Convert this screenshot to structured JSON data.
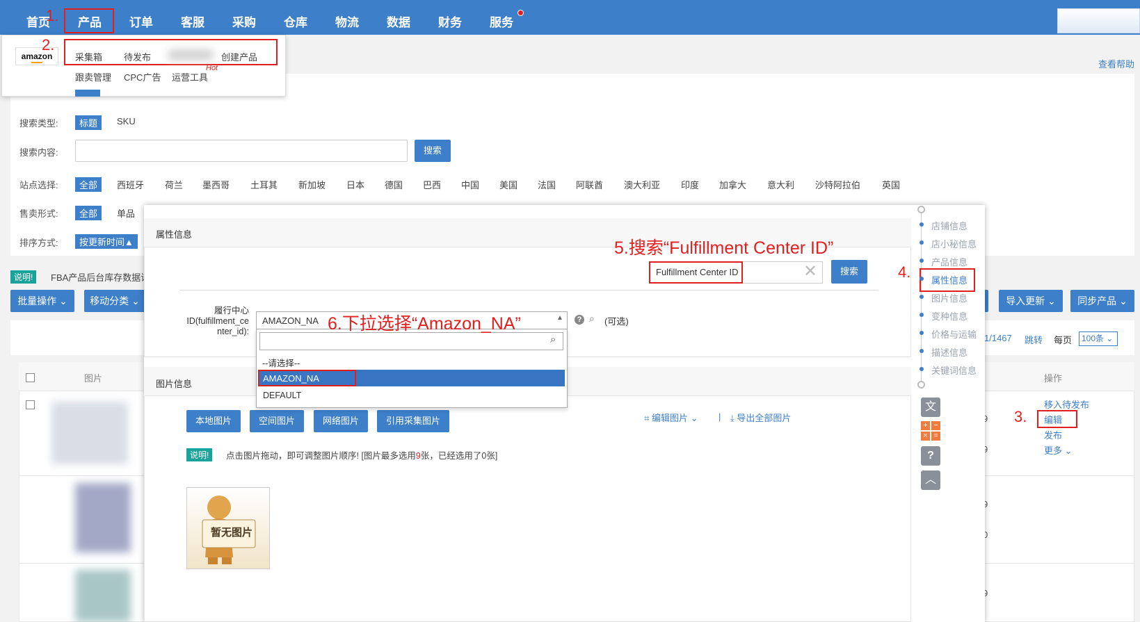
{
  "nav": {
    "items": [
      "首页",
      "产品",
      "订单",
      "客服",
      "采购",
      "仓库",
      "物流",
      "数据",
      "财务",
      "服务"
    ],
    "step1": "1.",
    "step2": "2."
  },
  "dropdown": {
    "logo": "amazon",
    "row1": [
      "采集箱",
      "待发布",
      "创建产品"
    ],
    "row2": [
      "跟卖管理",
      "CPC广告",
      "运营工具"
    ],
    "hot": "Hot"
  },
  "help_link": "查看帮助",
  "filters": {
    "search_type_label": "搜索类型:",
    "search_type_options": [
      "标题",
      "SKU"
    ],
    "search_content_label": "搜索内容:",
    "search_button": "搜索",
    "site_label": "站点选择:",
    "sites": [
      "全部",
      "西班牙",
      "荷兰",
      "墨西哥",
      "土耳其",
      "新加坡",
      "日本",
      "德国",
      "巴西",
      "中国",
      "美国",
      "法国",
      "阿联酋",
      "澳大利亚",
      "印度",
      "加拿大",
      "意大利",
      "沙特阿拉伯",
      "英国"
    ],
    "sale_label": "售卖形式:",
    "sale_options": [
      "全部",
      "单品"
    ],
    "sort_label": "排序方式:",
    "sort_value": "按更新时间▲"
  },
  "notice": {
    "badge": "说明!",
    "text": "FBA产品后台库存数据请"
  },
  "toolbar": {
    "batch": "批量操作",
    "move": "移动分类",
    "import": "导入更新",
    "sync": "同步产品"
  },
  "pagination": {
    "page": "1/1467",
    "jump": "跳转",
    "per_page_label": "每页",
    "per_page": "100条"
  },
  "table": {
    "col_image": "图片",
    "col_ops": "操作",
    "row1_nums": [
      "9",
      "9"
    ],
    "row2_nums": [
      "9",
      "0"
    ],
    "row3_nums": [
      "9"
    ]
  },
  "row_ops": [
    "移入待发布",
    "编辑",
    "发布",
    "更多"
  ],
  "step3": "3.",
  "modal": {
    "attr_section": "属性信息",
    "step5": "5.搜索“Fulfillment Center ID”",
    "attr_search_value": "Fulfillment Center ID",
    "search_btn": "搜索",
    "field_label_lines": [
      "履行中心",
      "ID(fulfillment_ce",
      "nter_id):"
    ],
    "select_value": "AMAZON_NA",
    "step6": "6.下拉选择“Amazon_NA”",
    "optional": "(可选)",
    "options": [
      "--请选择--",
      "AMAZON_NA",
      "DEFAULT"
    ],
    "img_section": "图片信息",
    "img_buttons": [
      "本地图片",
      "空间图片",
      "网络图片",
      "引用采集图片"
    ],
    "edit_images": "编辑图片",
    "export_images": "导出全部图片",
    "note_badge": "说明!",
    "note_text_a": "点击图片拖动，即可调整图片顺序! [图片最多选用",
    "note_count": "9",
    "note_text_b": "张，已经选用了0张]",
    "no_image": "暂无图片"
  },
  "side_nav": {
    "items": [
      "店铺信息",
      "店小秘信息",
      "产品信息",
      "属性信息",
      "图片信息",
      "变种信息",
      "价格与运输",
      "描述信息",
      "关键词信息"
    ],
    "step4": "4."
  },
  "colors": {
    "primary": "#3d7fc9",
    "annotation": "#e21f1f"
  }
}
